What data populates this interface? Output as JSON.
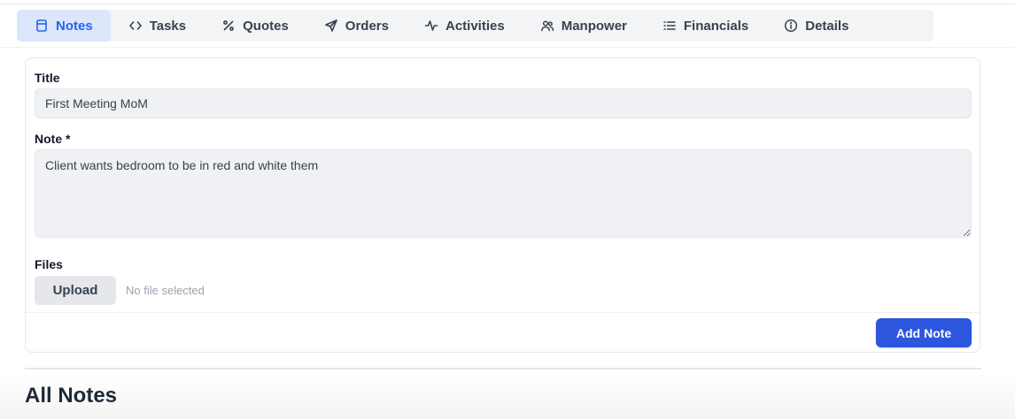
{
  "tabs": [
    {
      "label": "Notes",
      "icon": "notebook-icon",
      "active": true
    },
    {
      "label": "Tasks",
      "icon": "code-brackets-icon",
      "active": false
    },
    {
      "label": "Quotes",
      "icon": "percent-icon",
      "active": false
    },
    {
      "label": "Orders",
      "icon": "send-icon",
      "active": false
    },
    {
      "label": "Activities",
      "icon": "activity-pulse-icon",
      "active": false
    },
    {
      "label": "Manpower",
      "icon": "users-icon",
      "active": false
    },
    {
      "label": "Financials",
      "icon": "list-icon",
      "active": false
    },
    {
      "label": "Details",
      "icon": "info-icon",
      "active": false
    }
  ],
  "form": {
    "title_label": "Title",
    "title_value": "First Meeting MoM",
    "note_label": "Note *",
    "note_value": "Client wants bedroom to be in red and white them",
    "files_label": "Files",
    "upload_label": "Upload",
    "no_file_text": "No file selected",
    "submit_label": "Add Note"
  },
  "section": {
    "heading": "All Notes"
  },
  "colors": {
    "accent": "#2563eb",
    "primary_button": "#2c56dd",
    "active_tab_bg": "#dbe6fb"
  }
}
